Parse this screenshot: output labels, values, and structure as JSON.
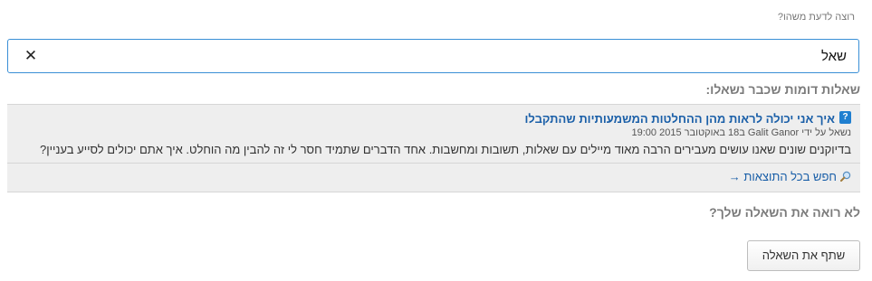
{
  "prompt_label": "רוצה לדעת משהו?",
  "search": {
    "value": "שאל",
    "clear_symbol": "✕"
  },
  "similar_title": "שאלות דומות שכבר נשאלו:",
  "results": [
    {
      "icon": "question-icon",
      "title": "איך אני יכולה לראות מהן ההחלטות המשמעותיות שהתקבלו",
      "meta": "נשאל על ידי Galit Ganor ב18 באוקטובר 2015 19:00",
      "excerpt": "בדיוקנים שונים שאנו עושים מעבירים הרבה מאוד מיילים עם שאלות, תשובות ומחשבות. אחד הדברים שתמיד חסר לי זה להבין מה הוחלט. איך אתם יכולים לסייע בעניין?"
    }
  ],
  "search_all_label": "חפש בכל התוצאות →",
  "not_found_label": "לא רואה את השאלה שלך?",
  "share_button_label": "שתף את השאלה",
  "colors": {
    "accent_border": "#3a8fd6",
    "link": "#1a5fa8",
    "icon_bg": "#1f7fd0",
    "panel_bg": "#eeeeee"
  }
}
